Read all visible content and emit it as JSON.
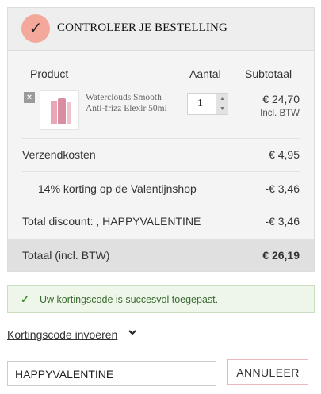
{
  "header": {
    "title": "CONTROLEER JE BESTELLING",
    "icon": "checkmark-icon",
    "icon_bg": "#f3a89b"
  },
  "columns": {
    "product": "Product",
    "quantity": "Aantal",
    "subtotal": "Subtotaal"
  },
  "item": {
    "remove_icon": "close-icon",
    "name": "Waterclouds Smooth Anti-frizz Elexir 50ml",
    "quantity": "1",
    "price": "€ 24,70",
    "vat_note": "Incl. BTW"
  },
  "summary": {
    "shipping_label": "Verzendkosten",
    "shipping_value": "€ 4,95",
    "discount_label": "14% korting op de Valentijnshop",
    "discount_value": "-€ 3,46",
    "total_discount_label": "Total discount: , HAPPYVALENTINE",
    "total_discount_value": "-€ 3,46",
    "total_label": "Totaal (incl. BTW)",
    "total_value": "€ 26,19"
  },
  "notice": {
    "text": "Uw kortingscode is succesvol toegepast.",
    "icon": "checkmark-icon",
    "color": "#3c8a2e"
  },
  "coupon": {
    "toggle_label": "Kortingscode invoeren",
    "toggle_icon": "chevron-down-icon",
    "input_value": "HAPPYVALENTINE",
    "cancel_label": "ANNULEER"
  }
}
